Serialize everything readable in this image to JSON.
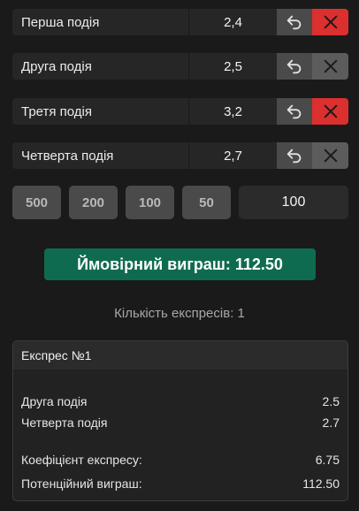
{
  "events": [
    {
      "name": "Перша подія",
      "odds": "2,4",
      "remove_state": "active"
    },
    {
      "name": "Друга подія",
      "odds": "2,5",
      "remove_state": "inactive"
    },
    {
      "name": "Третя подія",
      "odds": "3,2",
      "remove_state": "active"
    },
    {
      "name": "Четверта подія",
      "odds": "2,7",
      "remove_state": "inactive"
    }
  ],
  "icons": {
    "undo": "undo-icon",
    "remove": "close-icon"
  },
  "stake": {
    "quick_amounts": [
      "500",
      "200",
      "100",
      "50"
    ],
    "value": "100"
  },
  "potential_win_label": "Ймовірний виграш: 112.50",
  "express_count_label": "Кількість експресів: 1",
  "express": {
    "title": "Експрес №1",
    "selections": [
      {
        "name": "Друга подія",
        "odds": "2.5"
      },
      {
        "name": "Четверта подія",
        "odds": "2.7"
      }
    ],
    "coef_label": "Коефіцієнт експресу:",
    "coef_value": "6.75",
    "win_label": "Потенційний виграш:",
    "win_value": "112.50"
  },
  "colors": {
    "background": "#1a1a1a",
    "remove_active": "#dc2f2f",
    "remove_inactive": "#5c5c5c",
    "win_badge": "#0f6b4f"
  }
}
